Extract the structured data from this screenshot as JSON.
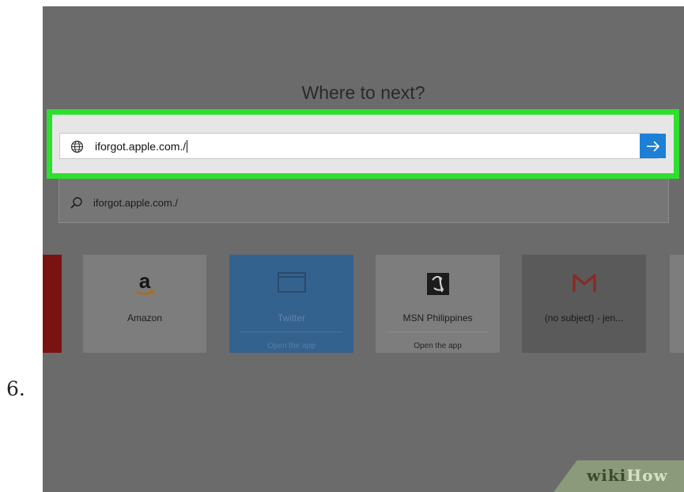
{
  "step": {
    "number": "6."
  },
  "browser": {
    "headline": "Where to next?",
    "address_bar": {
      "value": "iforgot.apple.com./",
      "icon": "globe-icon"
    },
    "go_button": {
      "icon": "arrow-right-icon"
    },
    "suggestions": [
      {
        "icon": "globe-icon",
        "text": "",
        "highlighted": true
      },
      {
        "icon": "search-icon",
        "text": "iforgot.apple.com./"
      }
    ],
    "tiles": [
      {
        "name": "",
        "sub": ""
      },
      {
        "name": "Amazon",
        "sub": "",
        "icon": "amazon-logo-icon"
      },
      {
        "name": "Twitter",
        "sub": "Open the app",
        "icon": "window-icon"
      },
      {
        "name": "MSN Philippines",
        "sub": "Open the app",
        "icon": "msn-logo-icon"
      },
      {
        "name": "(no subject) - jen...",
        "sub": "",
        "icon": "gmail-logo-icon"
      }
    ]
  },
  "watermark": {
    "wiki": "wiki",
    "how": "How"
  },
  "colors": {
    "highlight": "#2de02d",
    "accent": "#1d7fd6",
    "overlay": "#6b6b6b"
  }
}
